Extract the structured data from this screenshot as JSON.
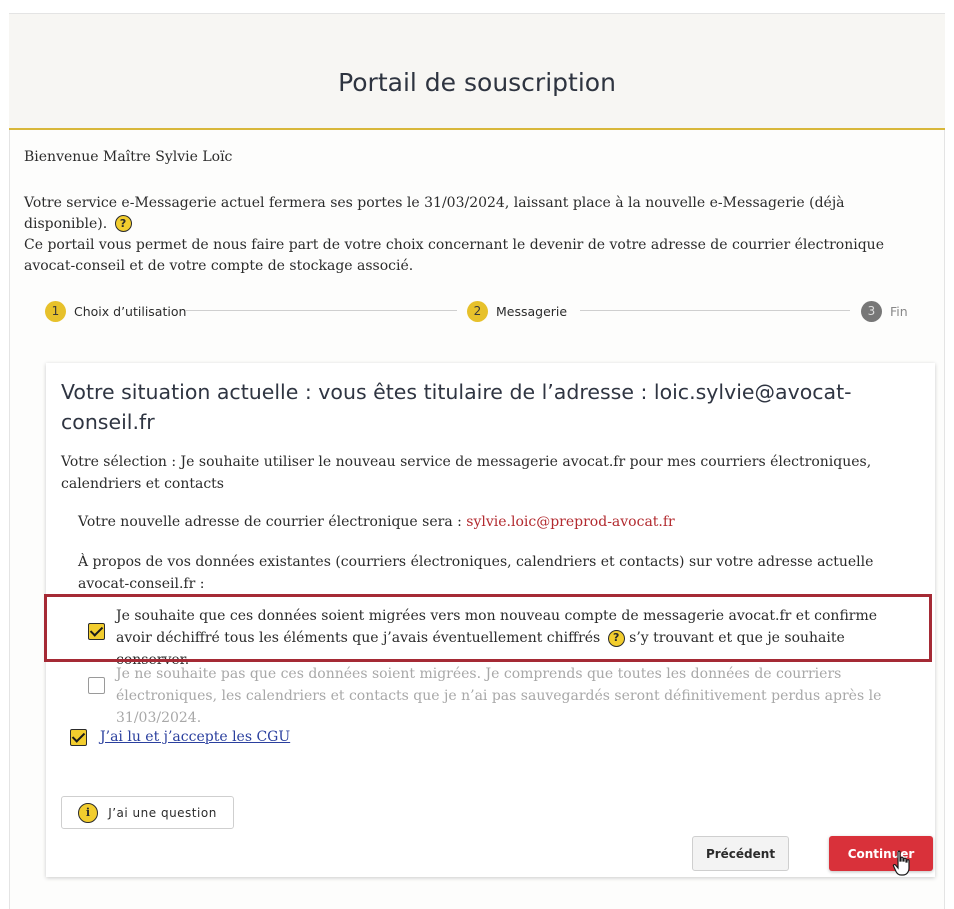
{
  "header": {
    "title": "Portail de souscription"
  },
  "intro": {
    "welcome": "Bienvenue Maître Sylvie Loïc",
    "notice": "Votre service e-Messagerie actuel fermera ses portes le 31/03/2024, laissant place à la nouvelle e-Messagerie (déjà disponible).",
    "purpose": "Ce portail vous permet de nous faire part de votre choix concernant le devenir de votre adresse de courrier électronique avocat-conseil et de votre compte de stockage associé."
  },
  "stepper": {
    "steps": [
      {
        "num": "1",
        "label": "Choix d’utilisation"
      },
      {
        "num": "2",
        "label": "Messagerie"
      },
      {
        "num": "3",
        "label": "Fin"
      }
    ]
  },
  "card": {
    "title": "Votre situation actuelle : vous êtes titulaire de l’adresse : loic.sylvie@avocat-conseil.fr",
    "selection": "Votre sélection : Je souhaite utiliser le nouveau service de messagerie avocat.fr pour mes courriers électroniques, calendriers et contacts",
    "new_address_label": "Votre nouvelle adresse de courrier électronique sera :",
    "new_address": "sylvie.loic@preprod-avocat.fr",
    "data_question": "À propos de vos données existantes (courriers électroniques, calendriers et contacts) sur votre adresse actuelle avocat-conseil.fr :",
    "option_migrate_part1": "Je souhaite que ces données soient migrées vers mon nouveau compte de messagerie avocat.fr et confirme avoir déchiffré tous les éléments que j’avais éventuellement chiffrés",
    "option_migrate_part2": "s’y trouvant et que je souhaite conserver.",
    "option_no_migrate": "Je ne souhaite pas que ces données soient migrées. Je comprends que toutes les données de courriers électroniques, les calendriers et contacts que je n’ai pas sauvegardés seront définitivement perdus après le 31/03/2024.",
    "cgu_label": "J’ai lu et j’accepte les CGU",
    "question_button": "J’ai une question",
    "prev_button": "Précédent",
    "continue_button": "Continuer"
  },
  "icons": {
    "help": "?",
    "info": "i"
  },
  "colors": {
    "accent_yellow": "#f2cd2e",
    "primary_red": "#d9313a",
    "highlight_border": "#a52a35"
  }
}
